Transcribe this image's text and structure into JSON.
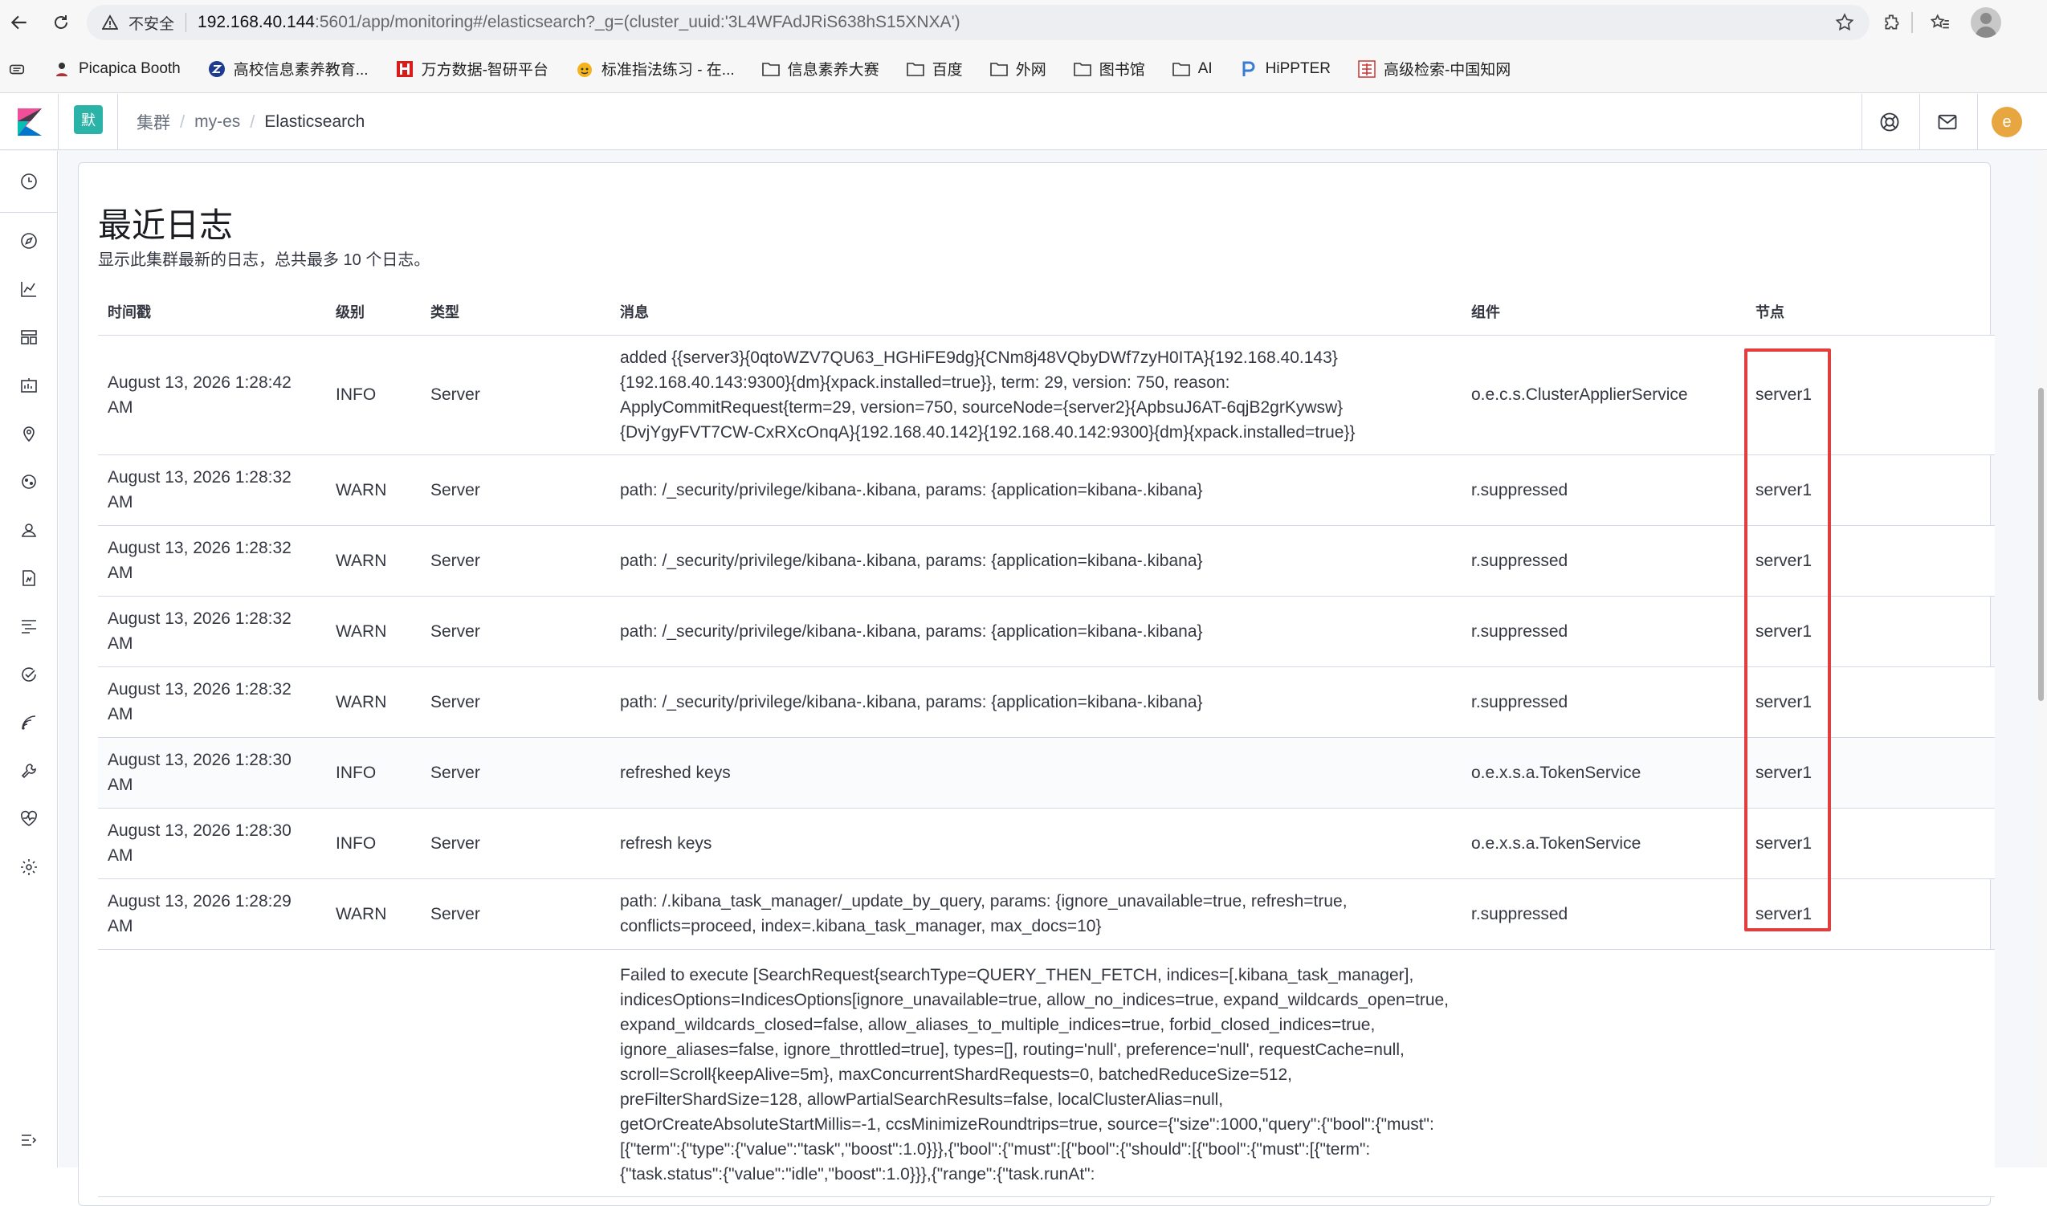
{
  "browser": {
    "insecure_label": "不安全",
    "url_host": "192.168.40.144",
    "url_path": ":5601/app/monitoring#/elasticsearch?_g=(cluster_uuid:'3L4WFAdJRiS638hS15XNXA')",
    "bookmarks": [
      {
        "label": "Picapica Booth",
        "icon": "person-icon"
      },
      {
        "label": "高校信息素养教育...",
        "icon": "z-logo-icon"
      },
      {
        "label": "万方数据-智研平台",
        "icon": "wanfang-icon"
      },
      {
        "label": "标准指法练习 - 在...",
        "icon": "emoji-icon"
      },
      {
        "label": "信息素养大赛",
        "icon": "folder-icon"
      },
      {
        "label": "百度",
        "icon": "folder-icon"
      },
      {
        "label": "外网",
        "icon": "folder-icon"
      },
      {
        "label": "图书馆",
        "icon": "folder-icon"
      },
      {
        "label": "AI",
        "icon": "folder-icon"
      },
      {
        "label": "HiPPTER",
        "icon": "p-logo-icon"
      },
      {
        "label": "高级检索-中国知网",
        "icon": "cnki-icon"
      }
    ]
  },
  "header": {
    "space_badge": "默",
    "breadcrumbs": [
      "集群",
      "my-es",
      "Elasticsearch"
    ],
    "avatar_letter": "e"
  },
  "logs": {
    "title": "最近日志",
    "subtitle": "显示此集群最新的日志，总共最多 10 个日志。",
    "columns": [
      "时间戳",
      "级别",
      "类型",
      "消息",
      "组件",
      "节点"
    ],
    "rows": [
      {
        "ts": "August 13, 2026 1:28:42 AM",
        "level": "INFO",
        "type": "Server",
        "message": "added {{server3}{0qtoWZV7QU63_HGHiFE9dg}{CNm8j48VQbyDWf7zyH0ITA}{192.168.40.143}{192.168.40.143:9300}{dm}{xpack.installed=true}}, term: 29, version: 750, reason: ApplyCommitRequest{term=29, version=750, sourceNode={server2}{ApbsuJ6AT-6qjB2grKywsw}{DvjYgyFVT7CW-CxRXcOnqA}{192.168.40.142}{192.168.40.142:9300}{dm}{xpack.installed=true}}",
        "component": "o.e.c.s.ClusterApplierService",
        "node": "server1"
      },
      {
        "ts": "August 13, 2026 1:28:32 AM",
        "level": "WARN",
        "type": "Server",
        "message": "path: /_security/privilege/kibana-.kibana, params: {application=kibana-.kibana}",
        "component": "r.suppressed",
        "node": "server1"
      },
      {
        "ts": "August 13, 2026 1:28:32 AM",
        "level": "WARN",
        "type": "Server",
        "message": "path: /_security/privilege/kibana-.kibana, params: {application=kibana-.kibana}",
        "component": "r.suppressed",
        "node": "server1"
      },
      {
        "ts": "August 13, 2026 1:28:32 AM",
        "level": "WARN",
        "type": "Server",
        "message": "path: /_security/privilege/kibana-.kibana, params: {application=kibana-.kibana}",
        "component": "r.suppressed",
        "node": "server1"
      },
      {
        "ts": "August 13, 2026 1:28:32 AM",
        "level": "WARN",
        "type": "Server",
        "message": "path: /_security/privilege/kibana-.kibana, params: {application=kibana-.kibana}",
        "component": "r.suppressed",
        "node": "server1"
      },
      {
        "ts": "August 13, 2026 1:28:30 AM",
        "level": "INFO",
        "type": "Server",
        "message": "refreshed keys",
        "component": "o.e.x.s.a.TokenService",
        "node": "server1"
      },
      {
        "ts": "August 13, 2026 1:28:30 AM",
        "level": "INFO",
        "type": "Server",
        "message": "refresh keys",
        "component": "o.e.x.s.a.TokenService",
        "node": "server1"
      },
      {
        "ts": "August 13, 2026 1:28:29 AM",
        "level": "WARN",
        "type": "Server",
        "message": "path: /.kibana_task_manager/_update_by_query, params: {ignore_unavailable=true, refresh=true, conflicts=proceed, index=.kibana_task_manager, max_docs=10}",
        "component": "r.suppressed",
        "node": "server1"
      },
      {
        "ts": "",
        "level": "",
        "type": "",
        "message": "Failed to execute [SearchRequest{searchType=QUERY_THEN_FETCH, indices=[.kibana_task_manager], indicesOptions=IndicesOptions[ignore_unavailable=true, allow_no_indices=true, expand_wildcards_open=true, expand_wildcards_closed=false, allow_aliases_to_multiple_indices=true, forbid_closed_indices=true, ignore_aliases=false, ignore_throttled=true], types=[], routing='null', preference='null', requestCache=null, scroll=Scroll{keepAlive=5m}, maxConcurrentShardRequests=0, batchedReduceSize=512, preFilterShardSize=128, allowPartialSearchResults=false, localClusterAlias=null, getOrCreateAbsoluteStartMillis=-1, ccsMinimizeRoundtrips=true, source={\"size\":1000,\"query\":{\"bool\":{\"must\":[{\"term\":{\"type\":{\"value\":\"task\",\"boost\":1.0}}},{\"bool\":{\"must\":[{\"bool\":{\"should\":[{\"bool\":{\"must\":[{\"term\":{\"task.status\":{\"value\":\"idle\",\"boost\":1.0}}},{\"range\":{\"task.runAt\":",
        "component": "",
        "node": ""
      }
    ]
  },
  "colors": {
    "highlight": "#e33e3e",
    "space_badge": "#2ab3a6",
    "avatar": "#e7a640"
  }
}
